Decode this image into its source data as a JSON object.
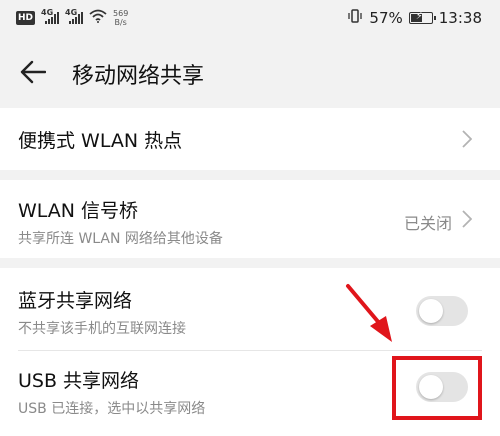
{
  "status_bar": {
    "hd": "HD",
    "sim1": "4G",
    "sim2": "4G",
    "speed_value": "569",
    "speed_unit": "B/s",
    "battery_percent": "57%",
    "battery_level": 0.57,
    "time": "13:38"
  },
  "header": {
    "title": "移动网络共享"
  },
  "items": {
    "hotspot": {
      "title": "便携式 WLAN 热点"
    },
    "bridge": {
      "title": "WLAN 信号桥",
      "subtitle": "共享所连 WLAN 网络给其他设备",
      "value": "已关闭"
    },
    "bluetooth": {
      "title": "蓝牙共享网络",
      "subtitle": "不共享该手机的互联网连接",
      "enabled": false
    },
    "usb": {
      "title": "USB 共享网络",
      "subtitle": "USB 已连接，选中以共享网络",
      "enabled": false
    }
  },
  "colors": {
    "background": "#f2f2f2",
    "card": "#ffffff",
    "annotation": "#e0151b",
    "toggle_off": "#e4e4e4"
  }
}
